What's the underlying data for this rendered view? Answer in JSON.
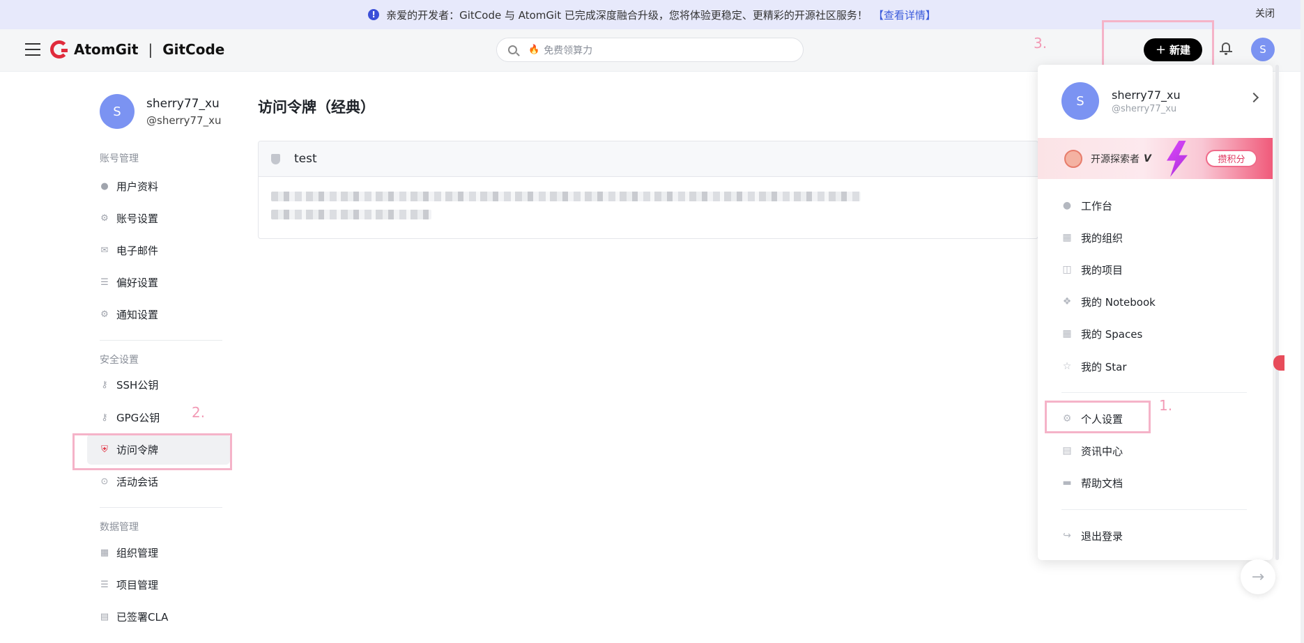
{
  "banner": {
    "icon": "info-icon",
    "text": "亲爱的开发者：GitCode 与 AtomGit 已完成深度融合升级，您将体验更稳定、更精彩的开源社区服务！",
    "link": "【查看详情】",
    "close": "关闭"
  },
  "header": {
    "logo_left": "AtomGit",
    "logo_sep": "|",
    "logo_right": "GitCode",
    "search_placeholder": "免费领算力",
    "new_button": "新建",
    "new_plus": "+",
    "avatar": "S"
  },
  "annotations": {
    "step1": "1.",
    "step2": "2.",
    "step3": "3."
  },
  "sidebar": {
    "avatar": "S",
    "username": "sherry77_xu",
    "handle": "@sherry77_xu",
    "sections": [
      {
        "title": "账号管理",
        "items": [
          "用户资料",
          "账号设置",
          "电子邮件",
          "偏好设置",
          "通知设置"
        ]
      },
      {
        "title": "安全设置",
        "items": [
          "SSH公钥",
          "GPG公钥",
          "访问令牌",
          "活动会话"
        ]
      },
      {
        "title": "数据管理",
        "items": [
          "组织管理",
          "项目管理",
          "已签署CLA"
        ]
      }
    ],
    "active_item": "访问令牌"
  },
  "main": {
    "title": "访问令牌（经典）",
    "token_name": "test"
  },
  "dropdown": {
    "avatar": "S",
    "username": "sherry77_xu",
    "handle": "@sherry77_xu",
    "promo_title": "开源探索者",
    "promo_badge": "V",
    "promo_button": "攒积分",
    "items_top": [
      "工作台",
      "我的组织",
      "我的项目",
      "我的 Notebook",
      "我的 Spaces",
      "我的 Star"
    ],
    "items_mid": [
      "个人设置",
      "资讯中心",
      "帮助文档"
    ],
    "logout": "退出登录"
  },
  "colors": {
    "brand_red": "#e02b3c",
    "banner_bg": "#e7e9fb",
    "avatar_blue": "#7b93f2",
    "annotation_pink": "#f5b3c8"
  }
}
